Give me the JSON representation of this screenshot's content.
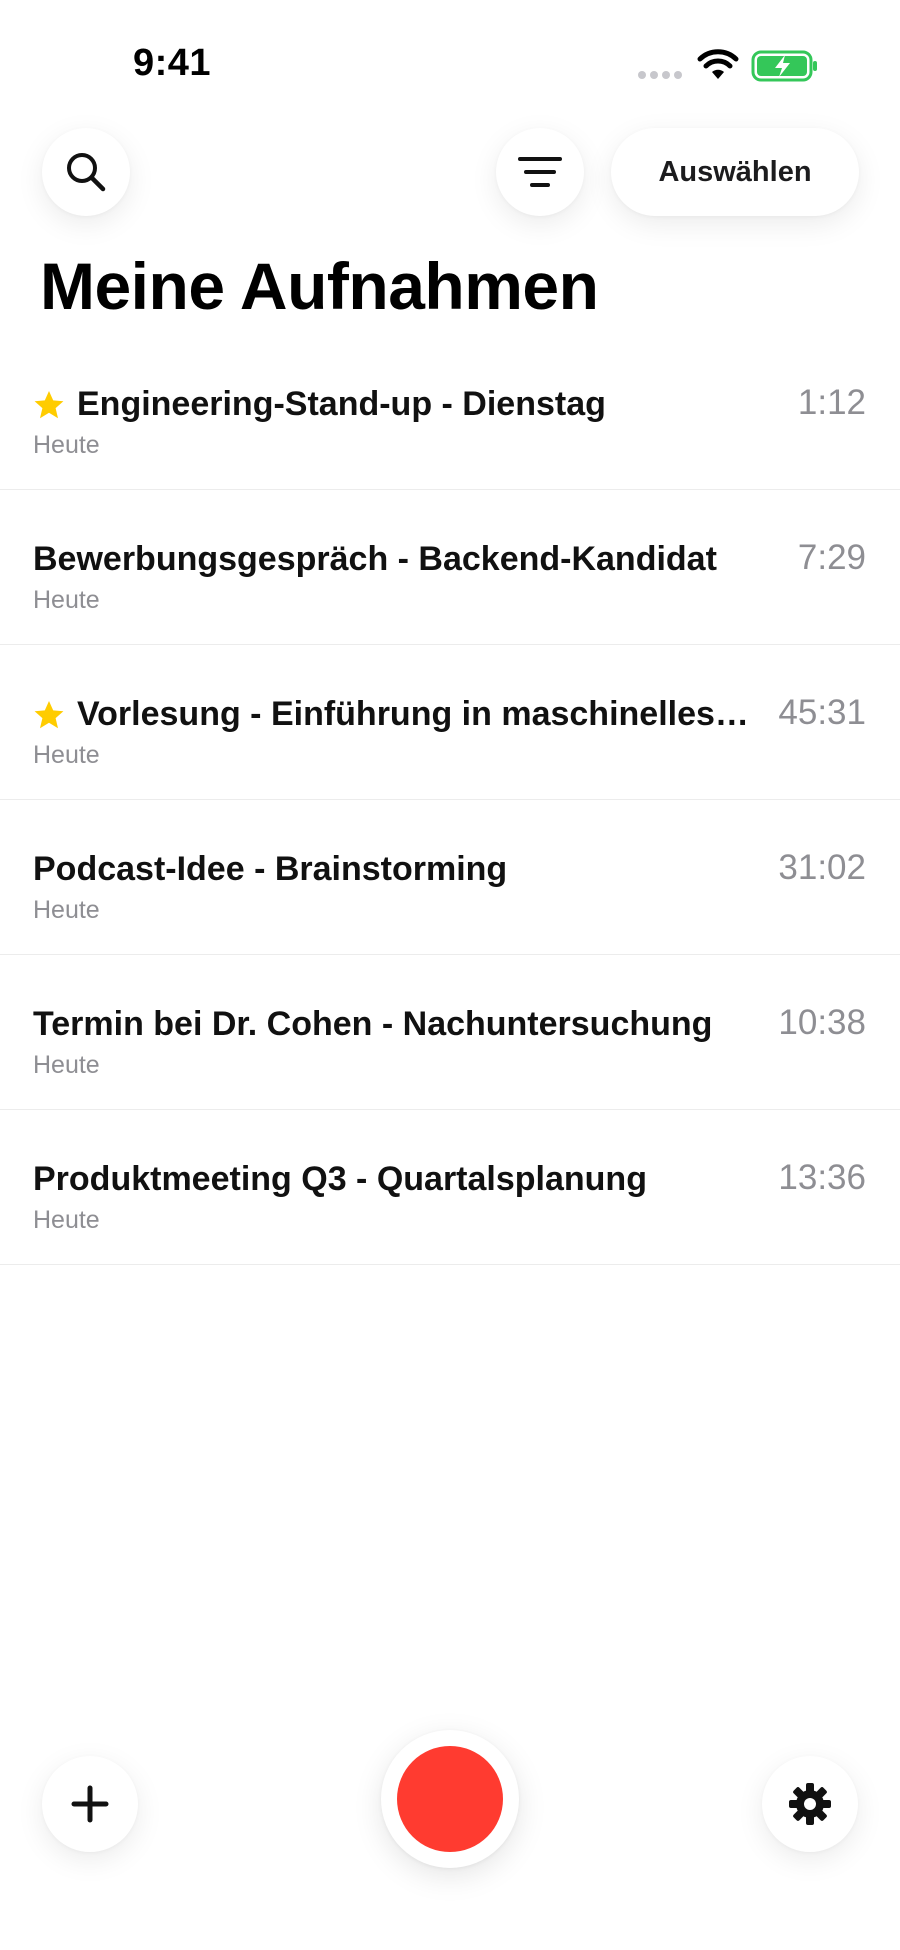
{
  "status_bar": {
    "time": "9:41"
  },
  "header": {
    "search_icon": "search-icon",
    "filter_icon": "filter-icon",
    "select_label": "Auswählen",
    "title": "Meine Aufnahmen"
  },
  "recordings": [
    {
      "title": "Engineering-Stand-up - Dienstag",
      "date": "Heute",
      "duration": "1:12",
      "starred": true
    },
    {
      "title": "Bewerbungsgespräch - Backend-Kandidat",
      "date": "Heute",
      "duration": "7:29",
      "starred": false
    },
    {
      "title": "Vorlesung - Einführung in maschinelles Le...",
      "date": "Heute",
      "duration": "45:31",
      "starred": true
    },
    {
      "title": "Podcast-Idee - Brainstorming",
      "date": "Heute",
      "duration": "31:02",
      "starred": false
    },
    {
      "title": "Termin bei Dr. Cohen - Nachuntersuchung",
      "date": "Heute",
      "duration": "10:38",
      "starred": false
    },
    {
      "title": "Produktmeeting Q3 - Quartalsplanung",
      "date": "Heute",
      "duration": "13:36",
      "starred": false
    }
  ],
  "bottom_bar": {
    "add_icon": "plus-icon",
    "record_icon": "record-icon",
    "settings_icon": "gear-icon"
  },
  "colors": {
    "record": "#ff3b30",
    "star": "#ffcc00",
    "battery": "#34c759",
    "secondary_text": "#8e8e93"
  }
}
